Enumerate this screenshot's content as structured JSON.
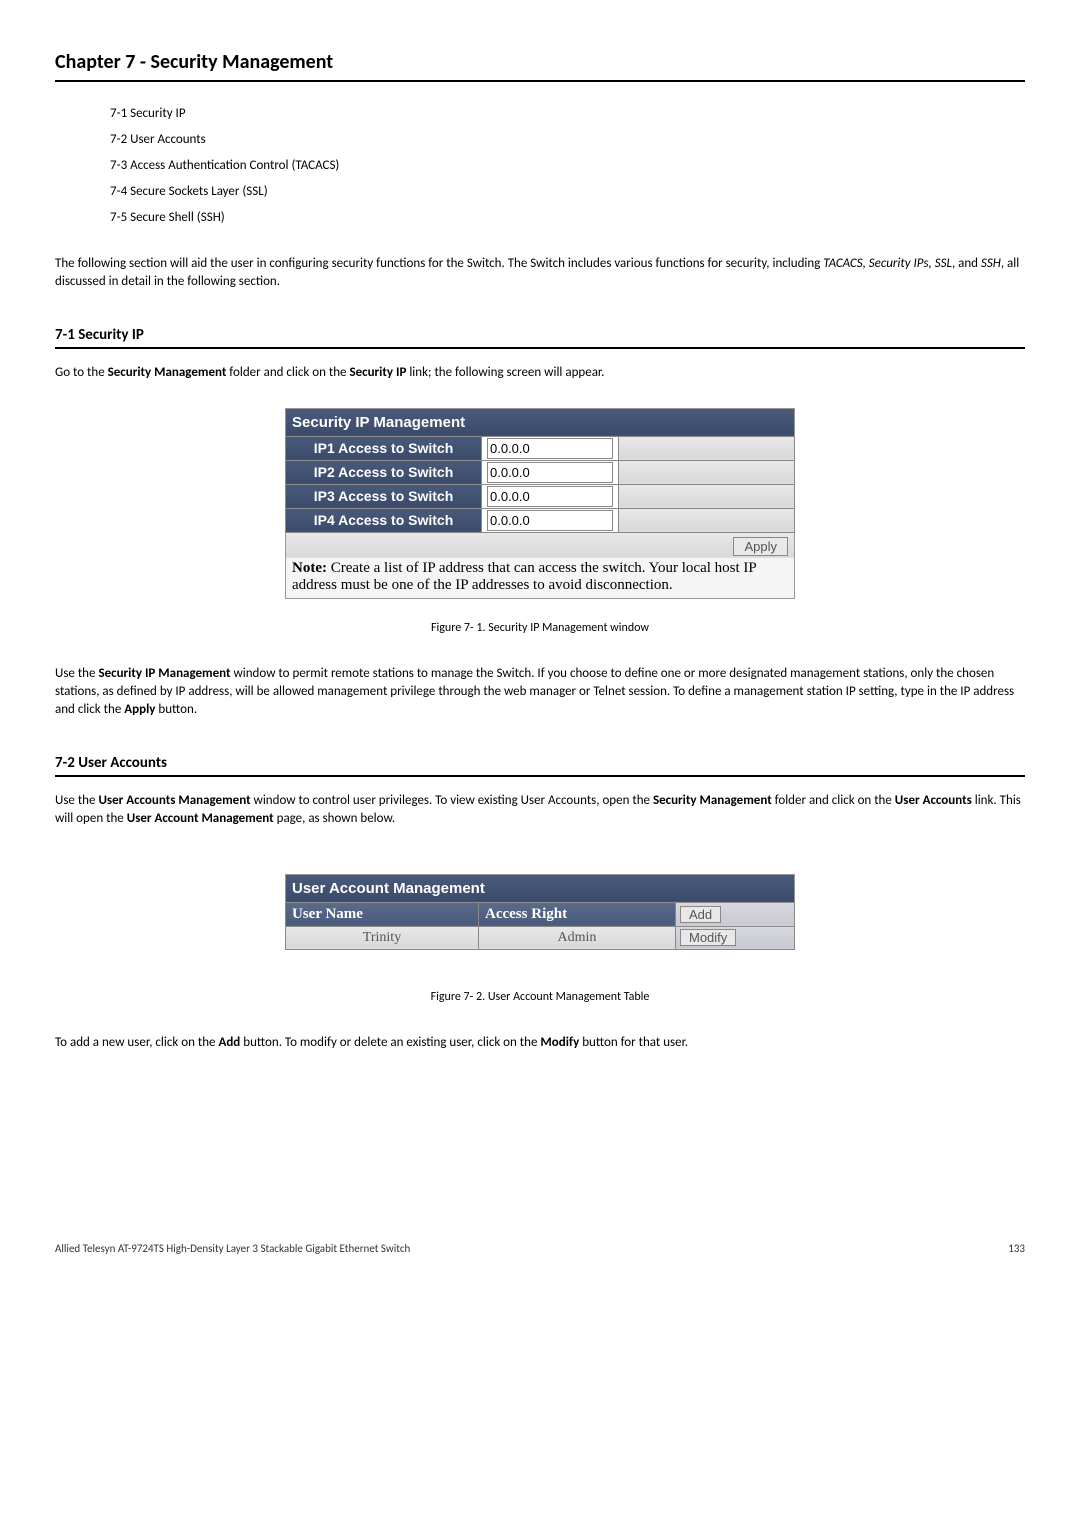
{
  "chapter_title": "Chapter 7 - Security Management",
  "toc": [
    "7-1 Security IP",
    "7-2 User Accounts",
    "7-3 Access Authentication Control (TACACS)",
    "7-4 Secure Sockets Layer (SSL)",
    "7-5 Secure Shell (SSH)"
  ],
  "intro_pre": "The following section will aid the user in configuring security functions for the Switch. The Switch includes various functions for security, including ",
  "intro_italic": "TACACS, Security IPs, SSL",
  "intro_mid": ", and ",
  "intro_italic2": "SSH",
  "intro_post": ", all discussed in detail in the following section.",
  "sec71": {
    "heading": "7-1 Security IP",
    "p1_pre": "Go to the ",
    "p1_b1": "Security Management",
    "p1_mid": " folder and click on the ",
    "p1_b2": "Security IP",
    "p1_post": " link; the following screen will appear.",
    "table_title": "Security IP Management",
    "rows": [
      {
        "label": "IP1 Access to Switch",
        "value": "0.0.0.0"
      },
      {
        "label": "IP2 Access to Switch",
        "value": "0.0.0.0"
      },
      {
        "label": "IP3 Access to Switch",
        "value": "0.0.0.0"
      },
      {
        "label": "IP4 Access to Switch",
        "value": "0.0.0.0"
      }
    ],
    "apply_label": "Apply",
    "note_bold": "Note:",
    "note_text": " Create a list of IP address that can access the switch. Your local host IP address must be one of the IP addresses to avoid disconnection.",
    "caption": "Figure 7- 1. Security IP Management window",
    "p2_pre": "Use the ",
    "p2_b1": "Security IP Management",
    "p2_mid": " window to permit remote stations to manage the Switch. If you choose to define one or more designated management stations, only the chosen stations, as defined by IP address, will be allowed management privilege through the web manager or Telnet session. To define a management station IP setting, type in the IP address and click the ",
    "p2_b2": "Apply",
    "p2_post": " button."
  },
  "sec72": {
    "heading": "7-2 User Accounts",
    "p1_pre": "Use the ",
    "p1_b1": "User Accounts Management",
    "p1_mid1": " window to control user privileges. To view existing User Accounts, open the ",
    "p1_b2": "Security Management",
    "p1_mid2": " folder and click on the ",
    "p1_b3": "User Accounts",
    "p1_mid3": " link. This will open the ",
    "p1_b4": "User Account Management",
    "p1_post": " page, as shown below.",
    "table_title": "User Account Management",
    "col_user": "User Name",
    "col_access": "Access Right",
    "add_label": "Add",
    "data_user": "Trinity",
    "data_access": "Admin",
    "modify_label": "Modify",
    "caption": "Figure 7- 2. User Account Management Table",
    "p2_pre": "To add a new user, click on the ",
    "p2_b1": "Add",
    "p2_mid": " button. To modify or delete an existing user, click on the ",
    "p2_b2": "Modify",
    "p2_post": " button for that user."
  },
  "footer_left": "Allied Telesyn AT-9724TS High-Density Layer 3 Stackable Gigabit Ethernet Switch",
  "footer_right": "133"
}
